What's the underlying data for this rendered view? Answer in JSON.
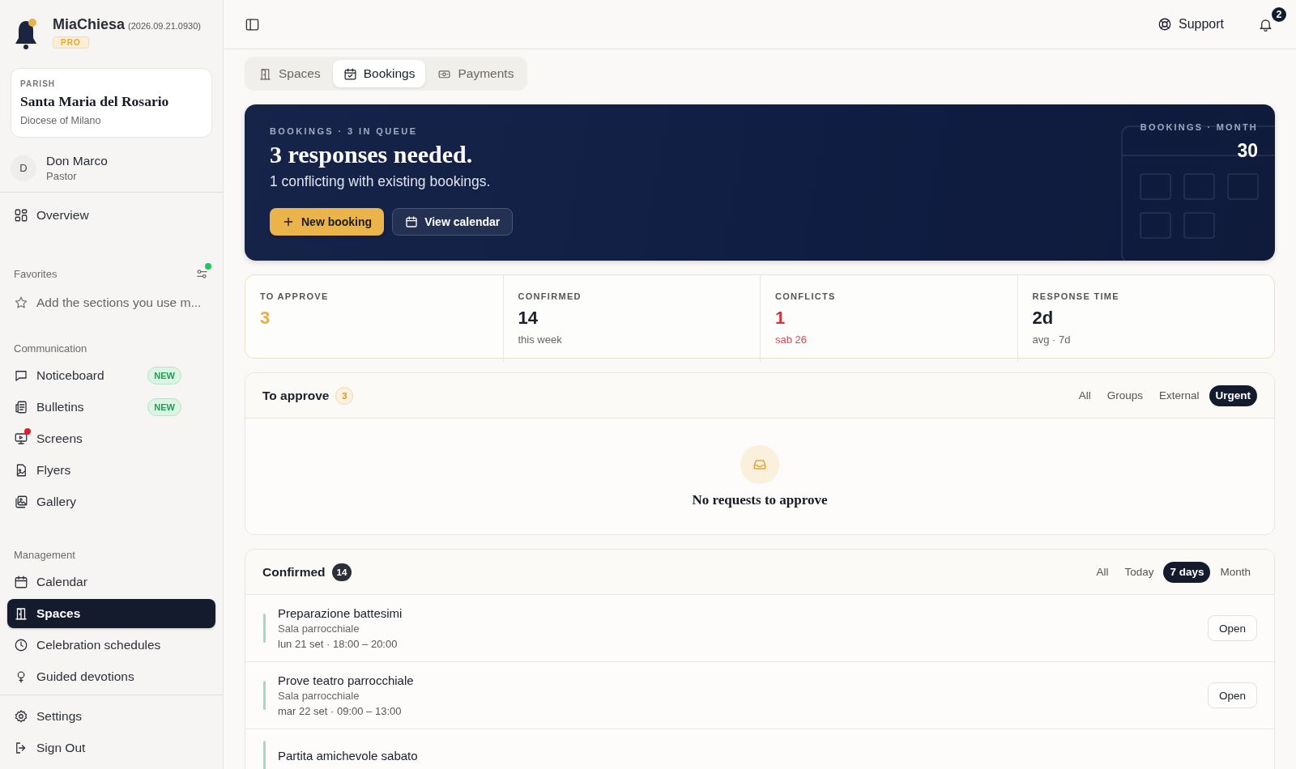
{
  "app": {
    "name": "MiaChiesa",
    "version": "(2026.09.21.0930)",
    "plan": "PRO"
  },
  "parish": {
    "label": "PARISH",
    "name": "Santa Maria del Rosario",
    "diocese": "Diocese of Milano"
  },
  "user": {
    "initial": "D",
    "name": "Don Marco",
    "role": "Pastor"
  },
  "nav_top": [
    {
      "label": "Overview",
      "selected": false
    }
  ],
  "favorites": {
    "title": "Favorites",
    "hint": "Add the sections you use m...",
    "has_update": true
  },
  "sections": [
    {
      "title": "Communication",
      "items": [
        {
          "label": "Noticeboard",
          "badge": "NEW",
          "alert": false,
          "selected": false
        },
        {
          "label": "Bulletins",
          "badge": "NEW",
          "alert": false,
          "selected": false
        },
        {
          "label": "Screens",
          "alert": true,
          "selected": false
        },
        {
          "label": "Flyers",
          "alert": false,
          "selected": false
        },
        {
          "label": "Gallery",
          "alert": false,
          "selected": false
        }
      ]
    },
    {
      "title": "Management",
      "items": [
        {
          "label": "Calendar",
          "alert": false,
          "selected": false
        },
        {
          "label": "Spaces",
          "alert": false,
          "selected": true
        },
        {
          "label": "Celebration schedules",
          "alert": false,
          "selected": false
        },
        {
          "label": "Guided devotions",
          "alert": false,
          "selected": false
        }
      ]
    }
  ],
  "footer_nav": [
    {
      "label": "Settings"
    },
    {
      "label": "Sign Out"
    }
  ],
  "topbar": {
    "support": "Support",
    "notifications": "2"
  },
  "tabs": [
    {
      "label": "Spaces",
      "selected": false
    },
    {
      "label": "Bookings",
      "selected": true
    },
    {
      "label": "Payments",
      "selected": false
    }
  ],
  "hero": {
    "eyebrow": "BOOKINGS · 3 IN QUEUE",
    "title": "3 responses needed.",
    "subtitle": "1 conflicting with existing bookings.",
    "month_label": "BOOKINGS · MONTH",
    "month_value": "30",
    "actions": [
      {
        "label": "New booking",
        "kind": "primary"
      },
      {
        "label": "View calendar",
        "kind": "secondary"
      }
    ]
  },
  "stats": [
    {
      "label": "TO APPROVE",
      "value": "3",
      "kind": "warning"
    },
    {
      "label": "CONFIRMED",
      "value": "14",
      "note": "this week",
      "kind": "plain"
    },
    {
      "label": "CONFLICTS",
      "value": "1",
      "note": "sab 26",
      "kind": "danger"
    },
    {
      "label": "RESPONSE TIME",
      "value": "2d",
      "note": "avg · 7d",
      "kind": "plain"
    }
  ],
  "to_approve": {
    "title": "To approve",
    "count": "3",
    "empty": "No requests to approve",
    "filters": [
      {
        "label": "All",
        "selected": false
      },
      {
        "label": "Groups",
        "selected": false
      },
      {
        "label": "External",
        "selected": false
      },
      {
        "label": "Urgent",
        "selected": true
      }
    ]
  },
  "confirmed": {
    "title": "Confirmed",
    "count": "14",
    "filters": [
      {
        "label": "All",
        "selected": false
      },
      {
        "label": "Today",
        "selected": false
      },
      {
        "label": "7 days",
        "selected": true
      },
      {
        "label": "Month",
        "selected": false
      }
    ],
    "rows": [
      {
        "title": "Preparazione battesimi",
        "place": "Sala parrocchiale",
        "time": "lun 21 set · 18:00 – 20:00",
        "action": "Open"
      },
      {
        "title": "Prove teatro parrocchiale",
        "place": "Sala parrocchiale",
        "time": "mar 22 set · 09:00 – 13:00",
        "action": "Open"
      },
      {
        "title": "Partita amichevole sabato"
      }
    ]
  }
}
